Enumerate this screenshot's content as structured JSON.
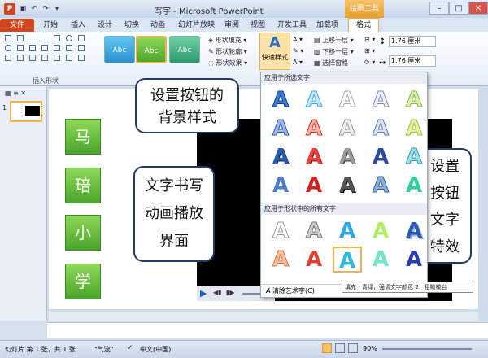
{
  "window": {
    "title": "写字 - Microsoft PowerPoint",
    "context_tab": "绘图工具"
  },
  "tabs": [
    "文件",
    "开始",
    "插入",
    "设计",
    "切换",
    "动画",
    "幻灯片放映",
    "审阅",
    "视图",
    "开发工具",
    "加载项",
    "格式"
  ],
  "ribbon": {
    "insert_shapes_group": "插入形状",
    "shape_fill": "形状填充",
    "shape_outline": "形状轮廓",
    "shape_effects": "形状效果",
    "quick_styles": "快速样式",
    "bring_forward": "上移一层",
    "send_backward": "下移一层",
    "selection_pane": "选择窗格",
    "height": "1.76 厘米",
    "width": "1.76 厘米",
    "style_label": "Abc"
  },
  "slide_panel": {
    "slide_number": "1"
  },
  "slide": {
    "chars": [
      "马",
      "琣",
      "小",
      "学"
    ]
  },
  "callouts": {
    "button_style": "设置按钮的背景样式",
    "text_animation": "文字书写动画播放界面",
    "button_text_effect": "设置按钮文字特效"
  },
  "gallery": {
    "section1": "应用于所选文字",
    "section2": "应用于形状中的所有文字",
    "clear": "清除艺术字(C)",
    "letter": "A"
  },
  "tooltip": "填充 - 青绿，强调文字颜色 2，粗糙棱台",
  "status": {
    "slide_info": "幻灯片 第 1 张，共 1 张",
    "theme": "\"气流\"",
    "language": "中文(中国)",
    "zoom": "90%"
  },
  "colors": {
    "file_tab": "#d0461e",
    "context_tab": "#e89e2b",
    "button_green": "#5fbf35"
  }
}
